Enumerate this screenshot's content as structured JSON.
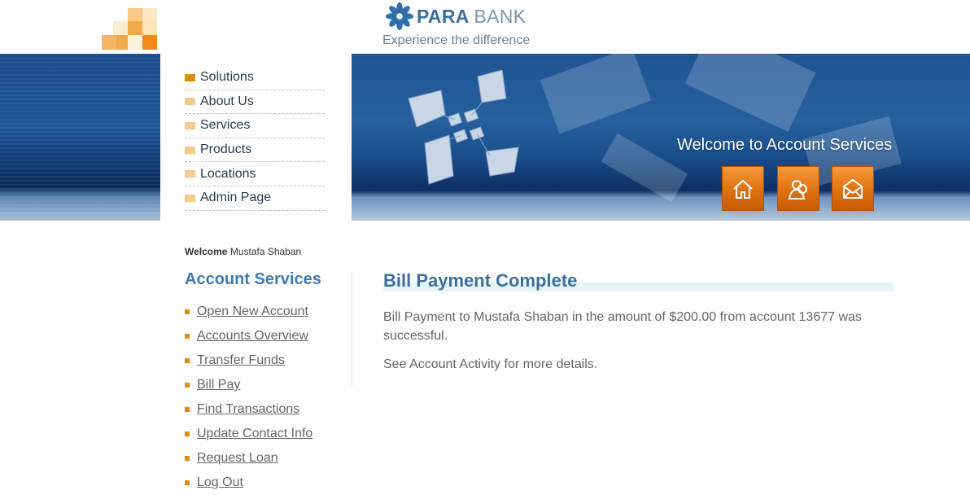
{
  "header": {
    "logo_name": "PARA",
    "logo_bank": "BANK",
    "caption": "Experience the difference",
    "brand_color": "#3a6f9e"
  },
  "nav_menu": [
    {
      "label": "Solutions"
    },
    {
      "label": "About Us"
    },
    {
      "label": "Services"
    },
    {
      "label": "Products"
    },
    {
      "label": "Locations"
    },
    {
      "label": "Admin Page"
    }
  ],
  "banner": {
    "title": "Welcome to Account Services",
    "buttons": [
      {
        "icon": "home-icon"
      },
      {
        "icon": "about-icon"
      },
      {
        "icon": "contact-icon"
      }
    ],
    "accent_color": "#e0710f"
  },
  "sidebar": {
    "welcome_label": "Welcome",
    "user_name": "Mustafa Shaban",
    "title": "Account Services",
    "links": [
      {
        "label": "Open New Account"
      },
      {
        "label": "Accounts Overview"
      },
      {
        "label": "Transfer Funds"
      },
      {
        "label": "Bill Pay"
      },
      {
        "label": "Find Transactions"
      },
      {
        "label": "Update Contact Info"
      },
      {
        "label": "Request Loan"
      },
      {
        "label": "Log Out"
      }
    ]
  },
  "main": {
    "title": "Bill Payment Complete",
    "message": "Bill Payment to Mustafa Shaban in the amount of $200.00 from account 13677 was successful.",
    "details": "See Account Activity for more details."
  }
}
